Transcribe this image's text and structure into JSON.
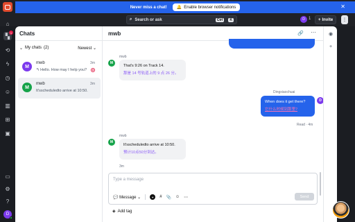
{
  "topbar": {
    "notice": "Never miss a chat!",
    "notify_button": "Enable browser notifications",
    "search_placeholder": "Search or ask",
    "kbd_ctrl": "Ctrl",
    "kbd_k": "K",
    "user_initial": "D",
    "user_count": "1",
    "invite_label": "Invite"
  },
  "rail": {
    "badge": "1",
    "avatar_initial": "D"
  },
  "chats": {
    "title": "Chats",
    "section": "My chats",
    "section_count": "(2)",
    "sort": "Newest",
    "items": [
      {
        "initial": "M",
        "name": "mwb",
        "time": "3m",
        "preview": "↰ Hello. How may I help you?",
        "avatar_color": "#7c3aed"
      },
      {
        "initial": "M",
        "name": "mwb",
        "time": "3m",
        "preview": "It'sscheduledto arrive at 10:50.",
        "avatar_color": "#16a34a"
      }
    ]
  },
  "conversation": {
    "title": "mwb",
    "messages": [
      {
        "sender": "mwb",
        "initial": "M",
        "text": "That's 9:26 on Track 14.",
        "translation": "那是 14 号轨道上的 9 点 26 分。"
      },
      {
        "sender": "Dingxiaochuai",
        "initial": "D",
        "text": "When does it get there?",
        "translation": "它什么时候到那里?",
        "status": "Read",
        "time": "4m"
      },
      {
        "sender": "mwb",
        "initial": "M",
        "text": "It'sscheduledto arrive at 10:50.",
        "translation": "预计10点50分到达。",
        "time": "3m"
      }
    ],
    "composer_placeholder": "Type a message",
    "message_mode": "Message",
    "send_label": "Send",
    "add_tag": "Add tag"
  }
}
